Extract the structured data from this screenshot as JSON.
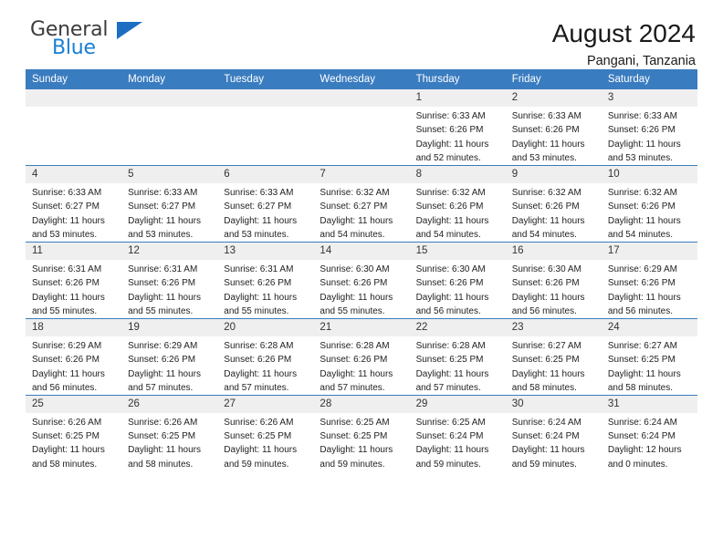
{
  "brand": {
    "name_top": "General",
    "name_bottom": "Blue",
    "accent_color": "#1b6ec2"
  },
  "header": {
    "title": "August 2024",
    "subtitle": "Pangani, Tanzania"
  },
  "theme": {
    "header_bar_color": "#3a7cc0",
    "daynum_bg": "#efefef",
    "text_color": "#222222"
  },
  "calendar": {
    "weekday_headers": [
      "Sunday",
      "Monday",
      "Tuesday",
      "Wednesday",
      "Thursday",
      "Friday",
      "Saturday"
    ],
    "weeks": [
      [
        {
          "day": "",
          "lines": []
        },
        {
          "day": "",
          "lines": []
        },
        {
          "day": "",
          "lines": []
        },
        {
          "day": "",
          "lines": []
        },
        {
          "day": "1",
          "lines": [
            "Sunrise: 6:33 AM",
            "Sunset: 6:26 PM",
            "Daylight: 11 hours",
            "and 52 minutes."
          ]
        },
        {
          "day": "2",
          "lines": [
            "Sunrise: 6:33 AM",
            "Sunset: 6:26 PM",
            "Daylight: 11 hours",
            "and 53 minutes."
          ]
        },
        {
          "day": "3",
          "lines": [
            "Sunrise: 6:33 AM",
            "Sunset: 6:26 PM",
            "Daylight: 11 hours",
            "and 53 minutes."
          ]
        }
      ],
      [
        {
          "day": "4",
          "lines": [
            "Sunrise: 6:33 AM",
            "Sunset: 6:27 PM",
            "Daylight: 11 hours",
            "and 53 minutes."
          ]
        },
        {
          "day": "5",
          "lines": [
            "Sunrise: 6:33 AM",
            "Sunset: 6:27 PM",
            "Daylight: 11 hours",
            "and 53 minutes."
          ]
        },
        {
          "day": "6",
          "lines": [
            "Sunrise: 6:33 AM",
            "Sunset: 6:27 PM",
            "Daylight: 11 hours",
            "and 53 minutes."
          ]
        },
        {
          "day": "7",
          "lines": [
            "Sunrise: 6:32 AM",
            "Sunset: 6:27 PM",
            "Daylight: 11 hours",
            "and 54 minutes."
          ]
        },
        {
          "day": "8",
          "lines": [
            "Sunrise: 6:32 AM",
            "Sunset: 6:26 PM",
            "Daylight: 11 hours",
            "and 54 minutes."
          ]
        },
        {
          "day": "9",
          "lines": [
            "Sunrise: 6:32 AM",
            "Sunset: 6:26 PM",
            "Daylight: 11 hours",
            "and 54 minutes."
          ]
        },
        {
          "day": "10",
          "lines": [
            "Sunrise: 6:32 AM",
            "Sunset: 6:26 PM",
            "Daylight: 11 hours",
            "and 54 minutes."
          ]
        }
      ],
      [
        {
          "day": "11",
          "lines": [
            "Sunrise: 6:31 AM",
            "Sunset: 6:26 PM",
            "Daylight: 11 hours",
            "and 55 minutes."
          ]
        },
        {
          "day": "12",
          "lines": [
            "Sunrise: 6:31 AM",
            "Sunset: 6:26 PM",
            "Daylight: 11 hours",
            "and 55 minutes."
          ]
        },
        {
          "day": "13",
          "lines": [
            "Sunrise: 6:31 AM",
            "Sunset: 6:26 PM",
            "Daylight: 11 hours",
            "and 55 minutes."
          ]
        },
        {
          "day": "14",
          "lines": [
            "Sunrise: 6:30 AM",
            "Sunset: 6:26 PM",
            "Daylight: 11 hours",
            "and 55 minutes."
          ]
        },
        {
          "day": "15",
          "lines": [
            "Sunrise: 6:30 AM",
            "Sunset: 6:26 PM",
            "Daylight: 11 hours",
            "and 56 minutes."
          ]
        },
        {
          "day": "16",
          "lines": [
            "Sunrise: 6:30 AM",
            "Sunset: 6:26 PM",
            "Daylight: 11 hours",
            "and 56 minutes."
          ]
        },
        {
          "day": "17",
          "lines": [
            "Sunrise: 6:29 AM",
            "Sunset: 6:26 PM",
            "Daylight: 11 hours",
            "and 56 minutes."
          ]
        }
      ],
      [
        {
          "day": "18",
          "lines": [
            "Sunrise: 6:29 AM",
            "Sunset: 6:26 PM",
            "Daylight: 11 hours",
            "and 56 minutes."
          ]
        },
        {
          "day": "19",
          "lines": [
            "Sunrise: 6:29 AM",
            "Sunset: 6:26 PM",
            "Daylight: 11 hours",
            "and 57 minutes."
          ]
        },
        {
          "day": "20",
          "lines": [
            "Sunrise: 6:28 AM",
            "Sunset: 6:26 PM",
            "Daylight: 11 hours",
            "and 57 minutes."
          ]
        },
        {
          "day": "21",
          "lines": [
            "Sunrise: 6:28 AM",
            "Sunset: 6:26 PM",
            "Daylight: 11 hours",
            "and 57 minutes."
          ]
        },
        {
          "day": "22",
          "lines": [
            "Sunrise: 6:28 AM",
            "Sunset: 6:25 PM",
            "Daylight: 11 hours",
            "and 57 minutes."
          ]
        },
        {
          "day": "23",
          "lines": [
            "Sunrise: 6:27 AM",
            "Sunset: 6:25 PM",
            "Daylight: 11 hours",
            "and 58 minutes."
          ]
        },
        {
          "day": "24",
          "lines": [
            "Sunrise: 6:27 AM",
            "Sunset: 6:25 PM",
            "Daylight: 11 hours",
            "and 58 minutes."
          ]
        }
      ],
      [
        {
          "day": "25",
          "lines": [
            "Sunrise: 6:26 AM",
            "Sunset: 6:25 PM",
            "Daylight: 11 hours",
            "and 58 minutes."
          ]
        },
        {
          "day": "26",
          "lines": [
            "Sunrise: 6:26 AM",
            "Sunset: 6:25 PM",
            "Daylight: 11 hours",
            "and 58 minutes."
          ]
        },
        {
          "day": "27",
          "lines": [
            "Sunrise: 6:26 AM",
            "Sunset: 6:25 PM",
            "Daylight: 11 hours",
            "and 59 minutes."
          ]
        },
        {
          "day": "28",
          "lines": [
            "Sunrise: 6:25 AM",
            "Sunset: 6:25 PM",
            "Daylight: 11 hours",
            "and 59 minutes."
          ]
        },
        {
          "day": "29",
          "lines": [
            "Sunrise: 6:25 AM",
            "Sunset: 6:24 PM",
            "Daylight: 11 hours",
            "and 59 minutes."
          ]
        },
        {
          "day": "30",
          "lines": [
            "Sunrise: 6:24 AM",
            "Sunset: 6:24 PM",
            "Daylight: 11 hours",
            "and 59 minutes."
          ]
        },
        {
          "day": "31",
          "lines": [
            "Sunrise: 6:24 AM",
            "Sunset: 6:24 PM",
            "Daylight: 12 hours",
            "and 0 minutes."
          ]
        }
      ]
    ]
  }
}
